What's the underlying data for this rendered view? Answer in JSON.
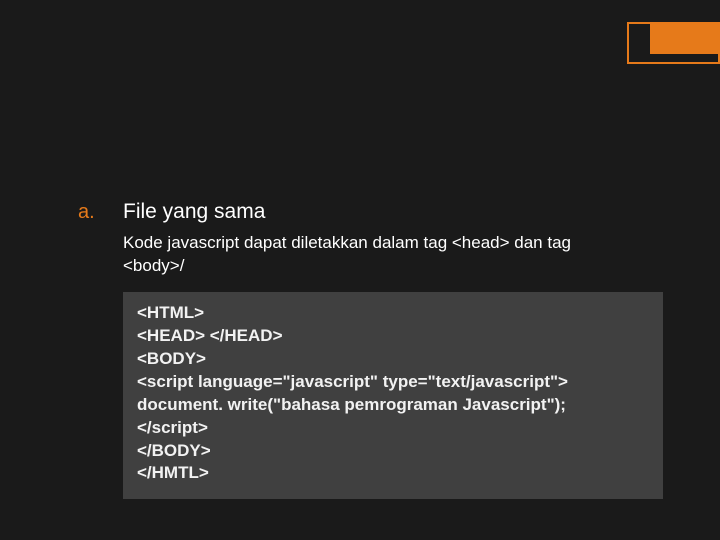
{
  "accent_color": "#e67a1a",
  "list": {
    "marker": "a.",
    "title": "File yang sama",
    "body": "Kode javascript dapat diletakkan dalam tag <head> dan tag <body>/"
  },
  "code": {
    "lines": [
      "<HTML>",
      "<HEAD> </HEAD>",
      "<BODY>",
      "<script language=\"javascript\" type=\"text/javascript\">",
      "document. write(\"bahasa pemrograman Javascript\");",
      "</script>",
      "</BODY>",
      "</HMTL>"
    ]
  }
}
